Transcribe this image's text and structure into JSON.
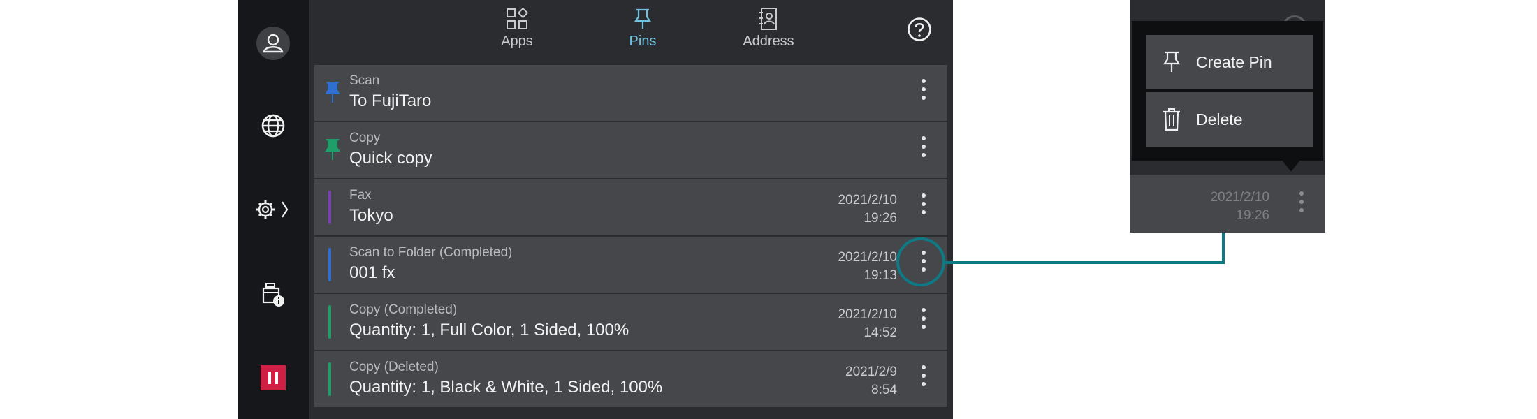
{
  "nav": {
    "tabs": [
      {
        "label": "Apps",
        "icon": "apps-icon",
        "active": false
      },
      {
        "label": "Pins",
        "icon": "pin-icon",
        "active": true
      },
      {
        "label": "Address",
        "icon": "address-book-icon",
        "active": false
      }
    ],
    "help_icon": "help-icon"
  },
  "sidebar": {
    "items": [
      {
        "icon": "user-icon"
      },
      {
        "icon": "globe-icon"
      },
      {
        "icon": "settings-icon"
      },
      {
        "icon": "device-info-icon"
      },
      {
        "icon": "pause-icon"
      }
    ],
    "pause_color": "#cf1f45"
  },
  "list": {
    "rows": [
      {
        "category": "Scan",
        "title": "To FujiTaro",
        "date": "",
        "time": "",
        "marker": "pin",
        "color": "#2f6fd0"
      },
      {
        "category": "Copy",
        "title": "Quick copy",
        "date": "",
        "time": "",
        "marker": "pin",
        "color": "#1f9e6a"
      },
      {
        "category": "Fax",
        "title": "Tokyo",
        "date": "2021/2/10",
        "time": "19:26",
        "marker": "bar",
        "color": "#7a3fb0"
      },
      {
        "category": "Scan to Folder (Completed)",
        "title": "001 fx",
        "date": "2021/2/10",
        "time": "19:13",
        "marker": "bar",
        "color": "#2f6fd0"
      },
      {
        "category": "Copy (Completed)",
        "title": "Quantity: 1, Full Color, 1 Sided, 100%",
        "date": "2021/2/10",
        "time": "14:52",
        "marker": "bar",
        "color": "#1f9e6a"
      },
      {
        "category": "Copy (Deleted)",
        "title": "Quantity: 1, Black & White, 1 Sided, 100%",
        "date": "2021/2/9",
        "time": "8:54",
        "marker": "bar",
        "color": "#1f9e6a"
      }
    ]
  },
  "popup": {
    "items": [
      {
        "label": "Create Pin",
        "icon": "pin-icon"
      },
      {
        "label": "Delete",
        "icon": "trash-icon"
      }
    ],
    "behind_date": "2021/2/10",
    "behind_time": "19:26"
  },
  "colors": {
    "accent": "#6fc1e0",
    "callout": "#0d7a86"
  }
}
